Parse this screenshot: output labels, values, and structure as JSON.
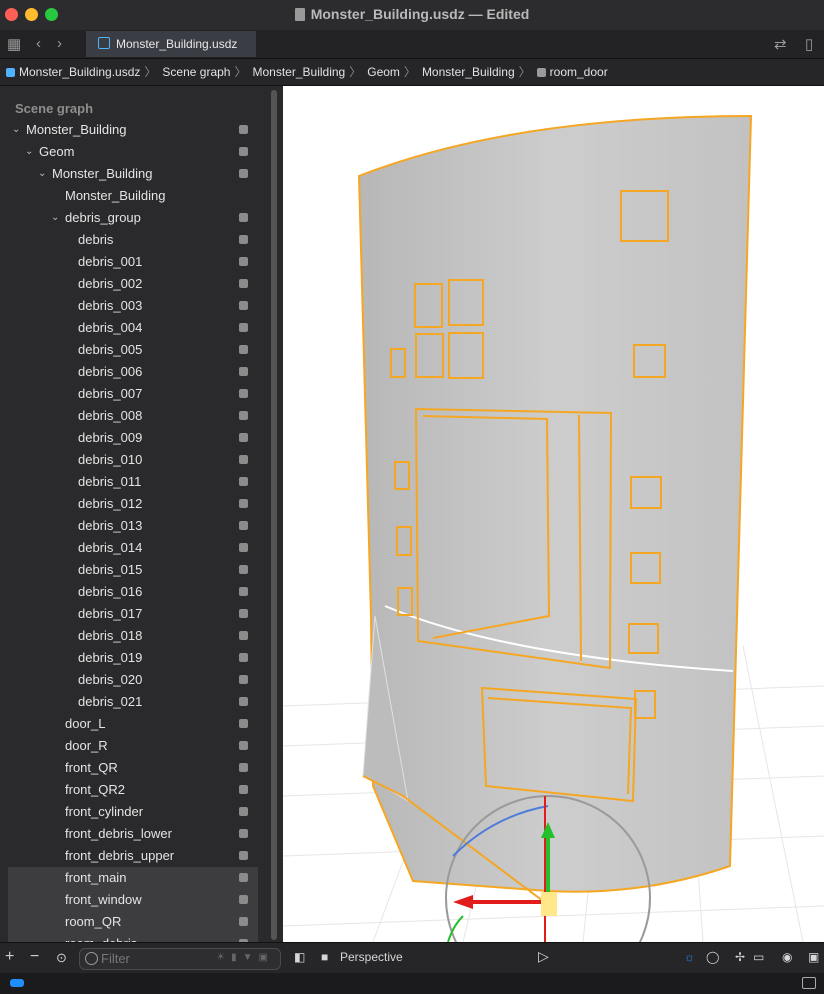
{
  "window": {
    "title": "Monster_Building.usdz — Edited",
    "tab_label": "Monster_Building.usdz"
  },
  "breadcrumb": [
    "Monster_Building.usdz",
    "Scene graph",
    "Monster_Building",
    "Geom",
    "Monster_Building",
    "room_door"
  ],
  "sidebar": {
    "title": "Scene graph",
    "filter_placeholder": "Filter",
    "items": [
      {
        "label": "Monster_Building",
        "depth": 0,
        "chevron": true,
        "cube": true,
        "selected": false
      },
      {
        "label": "Geom",
        "depth": 1,
        "chevron": true,
        "cube": true,
        "selected": false
      },
      {
        "label": "Monster_Building",
        "depth": 2,
        "chevron": true,
        "cube": true,
        "selected": false
      },
      {
        "label": "Monster_Building",
        "depth": 3,
        "chevron": false,
        "cube": false,
        "selected": false
      },
      {
        "label": "debris_group",
        "depth": 3,
        "chevron": true,
        "cube": true,
        "selected": false
      },
      {
        "label": "debris",
        "depth": 4,
        "chevron": false,
        "cube": true,
        "selected": false
      },
      {
        "label": "debris_001",
        "depth": 4,
        "chevron": false,
        "cube": true,
        "selected": false
      },
      {
        "label": "debris_002",
        "depth": 4,
        "chevron": false,
        "cube": true,
        "selected": false
      },
      {
        "label": "debris_003",
        "depth": 4,
        "chevron": false,
        "cube": true,
        "selected": false
      },
      {
        "label": "debris_004",
        "depth": 4,
        "chevron": false,
        "cube": true,
        "selected": false
      },
      {
        "label": "debris_005",
        "depth": 4,
        "chevron": false,
        "cube": true,
        "selected": false
      },
      {
        "label": "debris_006",
        "depth": 4,
        "chevron": false,
        "cube": true,
        "selected": false
      },
      {
        "label": "debris_007",
        "depth": 4,
        "chevron": false,
        "cube": true,
        "selected": false
      },
      {
        "label": "debris_008",
        "depth": 4,
        "chevron": false,
        "cube": true,
        "selected": false
      },
      {
        "label": "debris_009",
        "depth": 4,
        "chevron": false,
        "cube": true,
        "selected": false
      },
      {
        "label": "debris_010",
        "depth": 4,
        "chevron": false,
        "cube": true,
        "selected": false
      },
      {
        "label": "debris_011",
        "depth": 4,
        "chevron": false,
        "cube": true,
        "selected": false
      },
      {
        "label": "debris_012",
        "depth": 4,
        "chevron": false,
        "cube": true,
        "selected": false
      },
      {
        "label": "debris_013",
        "depth": 4,
        "chevron": false,
        "cube": true,
        "selected": false
      },
      {
        "label": "debris_014",
        "depth": 4,
        "chevron": false,
        "cube": true,
        "selected": false
      },
      {
        "label": "debris_015",
        "depth": 4,
        "chevron": false,
        "cube": true,
        "selected": false
      },
      {
        "label": "debris_016",
        "depth": 4,
        "chevron": false,
        "cube": true,
        "selected": false
      },
      {
        "label": "debris_017",
        "depth": 4,
        "chevron": false,
        "cube": true,
        "selected": false
      },
      {
        "label": "debris_018",
        "depth": 4,
        "chevron": false,
        "cube": true,
        "selected": false
      },
      {
        "label": "debris_019",
        "depth": 4,
        "chevron": false,
        "cube": true,
        "selected": false
      },
      {
        "label": "debris_020",
        "depth": 4,
        "chevron": false,
        "cube": true,
        "selected": false
      },
      {
        "label": "debris_021",
        "depth": 4,
        "chevron": false,
        "cube": true,
        "selected": false
      },
      {
        "label": "door_L",
        "depth": 3,
        "chevron": false,
        "cube": true,
        "selected": false
      },
      {
        "label": "door_R",
        "depth": 3,
        "chevron": false,
        "cube": true,
        "selected": false
      },
      {
        "label": "front_QR",
        "depth": 3,
        "chevron": false,
        "cube": true,
        "selected": false
      },
      {
        "label": "front_QR2",
        "depth": 3,
        "chevron": false,
        "cube": true,
        "selected": false
      },
      {
        "label": "front_cylinder",
        "depth": 3,
        "chevron": false,
        "cube": true,
        "selected": false
      },
      {
        "label": "front_debris_lower",
        "depth": 3,
        "chevron": false,
        "cube": true,
        "selected": false
      },
      {
        "label": "front_debris_upper",
        "depth": 3,
        "chevron": false,
        "cube": true,
        "selected": false
      },
      {
        "label": "front_main",
        "depth": 3,
        "chevron": false,
        "cube": true,
        "selected": true
      },
      {
        "label": "front_window",
        "depth": 3,
        "chevron": false,
        "cube": true,
        "selected": true
      },
      {
        "label": "room_QR",
        "depth": 3,
        "chevron": false,
        "cube": true,
        "selected": true
      },
      {
        "label": "room_debris",
        "depth": 3,
        "chevron": false,
        "cube": true,
        "selected": true
      }
    ]
  },
  "viewport": {
    "camera_label": "Perspective",
    "selection_color": "#f5a623",
    "model_color": "#c9c9c9"
  },
  "colors": {
    "accent": "#1f8fff",
    "gizmo_x": "#e21b1b",
    "gizmo_y": "#22c02a",
    "gizmo_z": "#4f7bd9"
  }
}
